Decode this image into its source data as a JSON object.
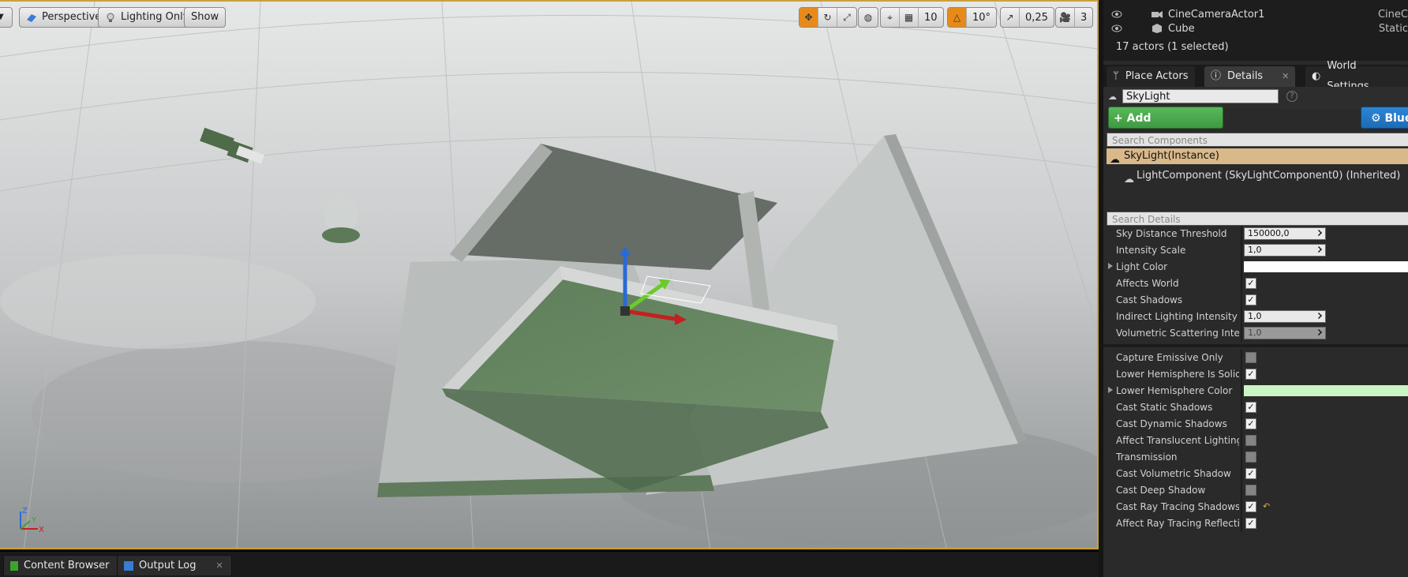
{
  "viewport": {
    "view_mode": "Perspective",
    "lighting_mode": "Lighting Only",
    "show_label": "Show",
    "grid_snap": "10",
    "rotation_snap": "10°",
    "scale_snap": "0,25",
    "camera_speed": "3",
    "axis": {
      "z": "Z",
      "y": "Y",
      "x": "X"
    }
  },
  "bottom_tabs": [
    {
      "label": "Content Browser"
    },
    {
      "label": "Output Log"
    }
  ],
  "outliner": {
    "rows": [
      {
        "label": "CineCameraActor1",
        "type": "CineC"
      },
      {
        "label": "Cube",
        "type": "Static"
      }
    ],
    "actor_count": "17 actors (1 selected)"
  },
  "panel_tabs": [
    {
      "label": "Place Actors"
    },
    {
      "label": "Details"
    },
    {
      "label": "World Settings"
    }
  ],
  "details": {
    "actor_name": "SkyLight",
    "add_component": "+ Add Component ▾",
    "blueprint": "Blue",
    "search_components_placeholder": "Search Components",
    "component_root": "SkyLight(Instance)",
    "component_child": "LightComponent (SkyLightComponent0) (Inherited)",
    "search_details_placeholder": "Search Details",
    "properties": [
      {
        "label": "Sky Distance Threshold",
        "value": "150000,0"
      },
      {
        "label": "Intensity Scale",
        "value": "1,0"
      },
      {
        "label": "Light Color"
      },
      {
        "label": "Affects World",
        "checked": true
      },
      {
        "label": "Cast Shadows",
        "checked": true
      },
      {
        "label": "Indirect Lighting Intensity",
        "value": "1,0"
      },
      {
        "label": "Volumetric Scattering Intensity",
        "value": "1,0"
      },
      {
        "label": "Capture Emissive Only",
        "checked": false
      },
      {
        "label": "Lower Hemisphere Is Solid Color",
        "checked": true
      },
      {
        "label": "Lower Hemisphere Color"
      },
      {
        "label": "Cast Static Shadows",
        "checked": true
      },
      {
        "label": "Cast Dynamic Shadows",
        "checked": true
      },
      {
        "label": "Affect Translucent Lighting",
        "checked": false
      },
      {
        "label": "Transmission",
        "checked": false
      },
      {
        "label": "Cast Volumetric Shadow",
        "checked": true
      },
      {
        "label": "Cast Deep Shadow",
        "checked": false
      },
      {
        "label": "Cast Ray Tracing Shadows",
        "checked": true
      },
      {
        "label": "Affect Ray Tracing Reflections",
        "checked": true
      }
    ],
    "check_glyph": "✓",
    "light_color": "#ffffff",
    "lower_hemisphere_color": "#c9f5c4"
  }
}
